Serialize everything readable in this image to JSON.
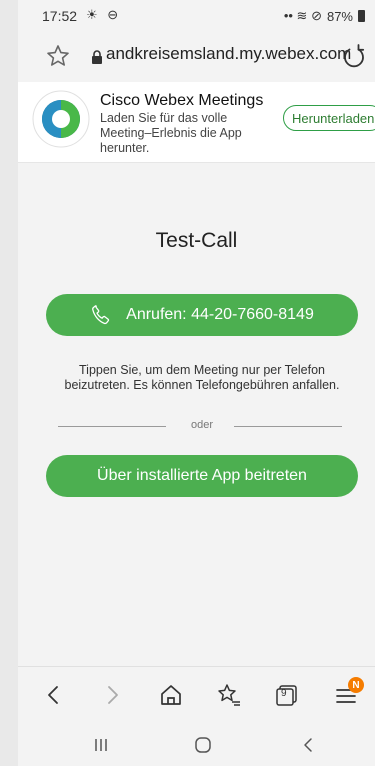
{
  "status_bar": {
    "time": "17:52",
    "left_icons": "☀ ⊖",
    "right_icons": "•• ≋ ⊘",
    "battery_percent": "87%"
  },
  "url_bar": {
    "url": "andkreisemsland.my.webex.com"
  },
  "app_banner": {
    "title": "Cisco Webex Meetings",
    "description": "Laden Sie für das volle Meeting–Erlebnis die App herunter.",
    "download_label": "Herunterladen"
  },
  "meeting": {
    "title": "Test-Call",
    "call_button_label": "Anrufen: 44-20-7660-8149",
    "phone_info": "Tippen Sie, um dem Meeting nur per Telefon beizutreten. Es können Telefongebühren anfallen.",
    "or_label": "oder",
    "app_join_label": "Über installierte App beitreten"
  },
  "bottom_nav": {
    "tabs_count": "9",
    "notification_badge": "N"
  },
  "colors": {
    "accent_green": "#4caf50",
    "badge_orange": "#f57c00"
  }
}
